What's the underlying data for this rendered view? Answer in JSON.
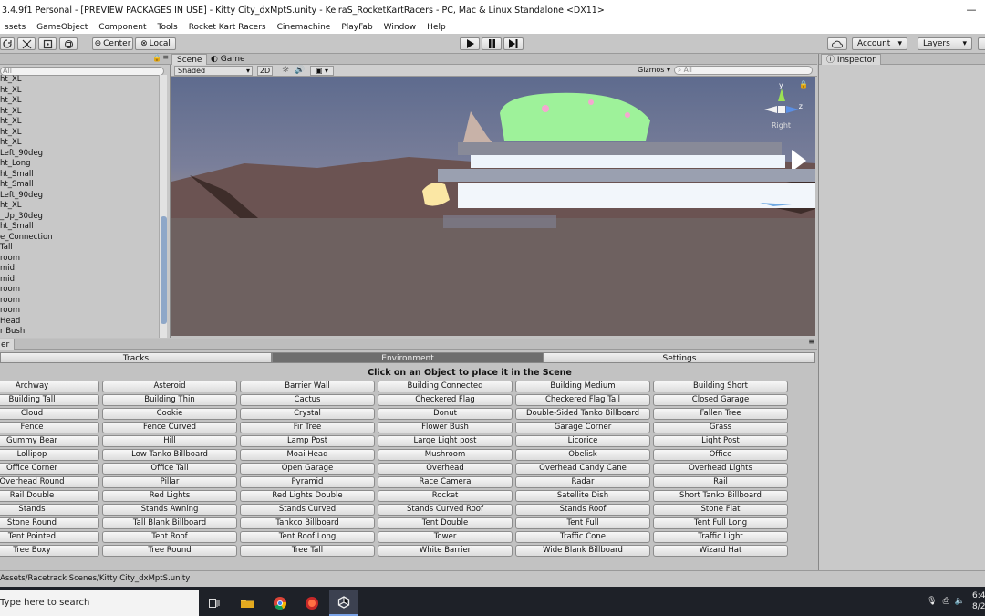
{
  "window": {
    "title": "3.4.9f1 Personal - [PREVIEW PACKAGES IN USE] - Kitty City_dxMptS.unity - KeiraS_RocketKartRacers - PC, Mac & Linux Standalone <DX11>",
    "minimize": "—"
  },
  "menu": [
    "ssets",
    "GameObject",
    "Component",
    "Tools",
    "Rocket Kart Racers",
    "Cinemachine",
    "PlayFab",
    "Window",
    "Help"
  ],
  "toolbar": {
    "center_label": "Center",
    "local_label": "Local",
    "account_label": "Account",
    "layers_label": "Layers"
  },
  "hierarchy": {
    "search_placeholder": "All",
    "items": [
      "ht_XL",
      "ht_XL",
      "ht_XL",
      "ht_XL",
      "ht_XL",
      "ht_XL",
      "ht_XL",
      "Left_90deg",
      "ht_Long",
      "ht_Small",
      "ht_Small",
      "Left_90deg",
      "ht_XL",
      "_Up_30deg",
      "ht_Small",
      "e_Connection",
      "Tall",
      "room",
      "mid",
      "mid",
      "room",
      "room",
      "room",
      "Head",
      "r Bush"
    ]
  },
  "scene": {
    "tab_scene": "Scene",
    "tab_game": "Game",
    "shading": "Shaded",
    "mode_2d": "2D",
    "gizmos": "Gizmos",
    "search_placeholder": "All",
    "gizmo_y": "y",
    "gizmo_z": "z",
    "axis_label": "Right"
  },
  "inspector": {
    "tab": "Inspector"
  },
  "placer": {
    "panel_tab": "er",
    "tabs": [
      "Tracks",
      "Environment",
      "Settings"
    ],
    "instruction": "Click on an Object to place it in the Scene",
    "objects": [
      "Archway",
      "Asteroid",
      "Barrier Wall",
      "Building Connected",
      "Building Medium",
      "Building Short",
      "Building Tall",
      "Building Thin",
      "Cactus",
      "Checkered Flag",
      "Checkered Flag Tall",
      "Closed Garage",
      "Cloud",
      "Cookie",
      "Crystal",
      "Donut",
      "Double-Sided Tanko Billboard",
      "Fallen Tree",
      "Fence",
      "Fence Curved",
      "Fir Tree",
      "Flower Bush",
      "Garage Corner",
      "Grass",
      "Gummy Bear",
      "Hill",
      "Lamp Post",
      "Large Light post",
      "Licorice",
      "Light Post",
      "Lollipop",
      "Low Tanko Billboard",
      "Moai Head",
      "Mushroom",
      "Obelisk",
      "Office",
      "Office Corner",
      "Office Tall",
      "Open Garage",
      "Overhead",
      "Overhead Candy Cane",
      "Overhead Lights",
      "Overhead Round",
      "Pillar",
      "Pyramid",
      "Race Camera",
      "Radar",
      "Rail",
      "Rail Double",
      "Red Lights",
      "Red Lights Double",
      "Rocket",
      "Satellite Dish",
      "Short Tanko Billboard",
      "Stands",
      "Stands Awning",
      "Stands Curved",
      "Stands Curved Roof",
      "Stands Roof",
      "Stone Flat",
      "Stone Round",
      "Tall Blank Billboard",
      "Tankco Billboard",
      "Tent Double",
      "Tent Full",
      "Tent Full Long",
      "Tent Pointed",
      "Tent Roof",
      "Tent Roof Long",
      "Tower",
      "Traffic Cone",
      "Traffic Light",
      "Tree Boxy",
      "Tree Round",
      "Tree Tall",
      "White Barrier",
      "Wide Blank Billboard",
      "Wizard Hat"
    ]
  },
  "status": {
    "path": "Assets/Racetrack Scenes/Kitty City_dxMptS.unity"
  },
  "taskbar": {
    "search_placeholder": "Type here to search",
    "time": "6:4",
    "date": "8/2"
  }
}
